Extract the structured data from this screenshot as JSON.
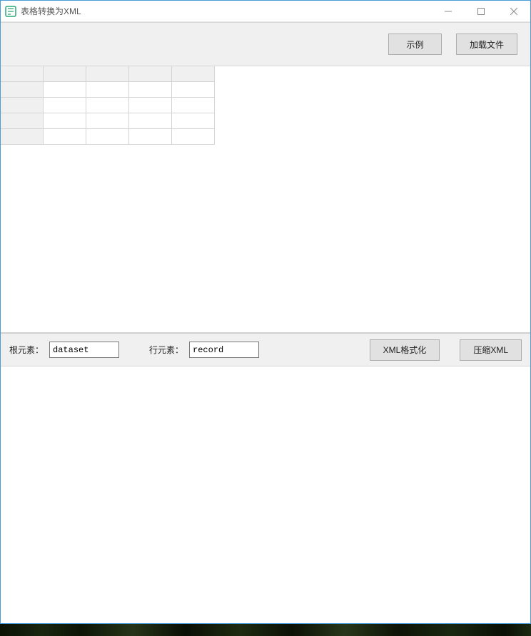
{
  "window": {
    "title": "表格转换为XML"
  },
  "toolbar": {
    "example_label": "示例",
    "load_file_label": "加载文件"
  },
  "table": {
    "columns": [
      "",
      "",
      "",
      ""
    ],
    "rows": [
      [
        "",
        "",
        "",
        ""
      ],
      [
        "",
        "",
        "",
        ""
      ],
      [
        "",
        "",
        "",
        ""
      ],
      [
        "",
        "",
        "",
        ""
      ]
    ]
  },
  "middle": {
    "root_label": "根元素：",
    "root_value": "dataset",
    "row_label": "行元素：",
    "row_value": "record",
    "format_label": "XML格式化",
    "compress_label": "压缩XML"
  }
}
